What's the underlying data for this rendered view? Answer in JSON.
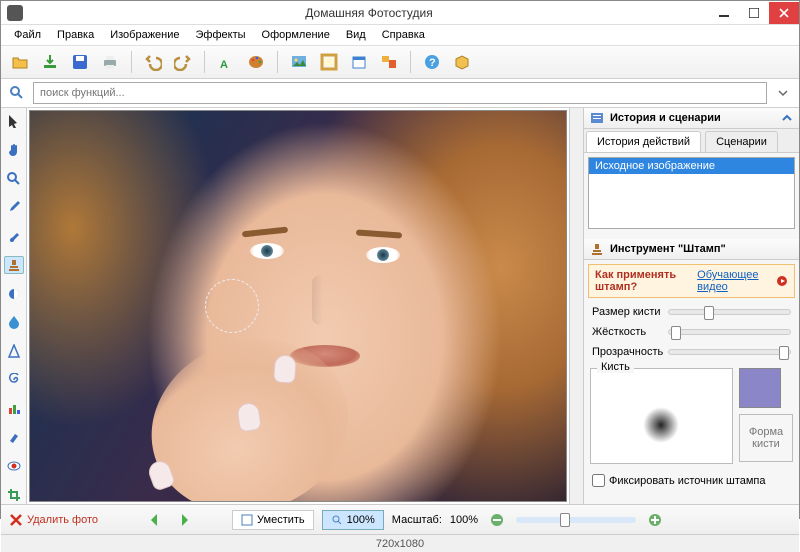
{
  "window": {
    "title": "Домашняя Фотостудия"
  },
  "menu": {
    "file": "Файл",
    "edit": "Правка",
    "image": "Изображение",
    "effects": "Эффекты",
    "design": "Оформление",
    "view": "Вид",
    "help": "Справка"
  },
  "toolbar": {
    "icons": [
      "folder-open",
      "export",
      "save",
      "print",
      "undo",
      "redo",
      "text",
      "palette",
      "image-insert",
      "frame",
      "calendar",
      "collage",
      "help",
      "box"
    ]
  },
  "search": {
    "placeholder": "поиск функций..."
  },
  "left_tools": [
    "pointer",
    "hand",
    "zoom",
    "eyedropper",
    "brush",
    "stamp",
    "contrast",
    "blur",
    "sharpen",
    "spiral",
    "levels",
    "smudge",
    "redeye",
    "crop"
  ],
  "left_active_index": 5,
  "panels": {
    "history_title": "История и сценарии",
    "tabs": {
      "history": "История действий",
      "scenarios": "Сценарии"
    },
    "history_items": [
      "Исходное изображение"
    ],
    "tool_title": "Инструмент \"Штамп\"",
    "hint_q": "Как применять штамп?",
    "hint_link": "Обучающее видео",
    "sliders": {
      "size": "Размер кисти",
      "hardness": "Жёсткость",
      "opacity": "Прозрачность"
    },
    "brush_label": "Кисть",
    "shape_label": "Форма кисти",
    "fix_source": "Фиксировать источник штампа",
    "swatch_color": "#8a86c8"
  },
  "bottom": {
    "delete": "Удалить фото",
    "fit": "Уместить",
    "zoom_btn": "100%",
    "scale_label": "Масштаб:",
    "scale_value": "100%"
  },
  "status": {
    "dims": "720x1080"
  }
}
